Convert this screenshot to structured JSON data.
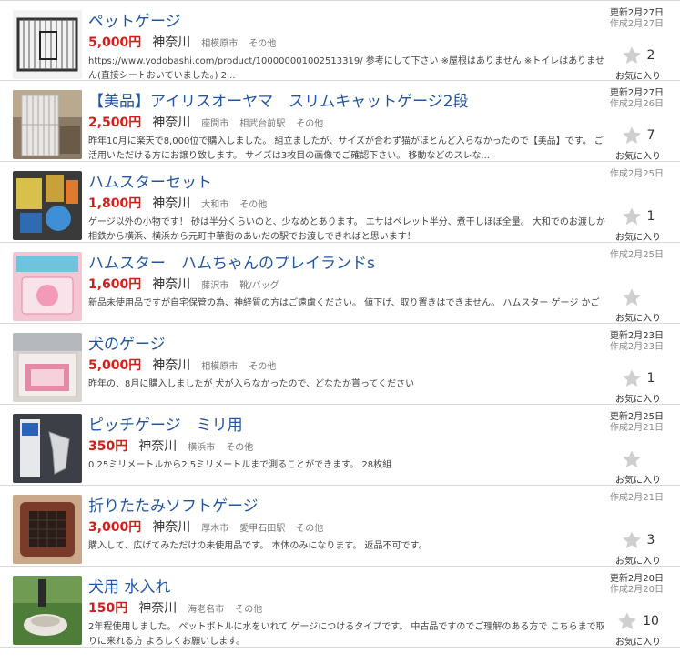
{
  "listings": [
    {
      "title": "ペットゲージ",
      "price": "5,000円",
      "prefecture": "神奈川",
      "city": "相模原市",
      "station": "",
      "category": "その他",
      "description": "https://www.yodobashi.com/product/100000001002513319/ 参考にして下さい ※屋根はありません ※トイレはありません(直接シートおいていました。) 2...",
      "updated": "更新2月27日",
      "created": "作成2月27日",
      "favorites": "2",
      "favorites_label": "お気に入り",
      "thumbnail": "cage-photo"
    },
    {
      "title": "【美品】アイリスオーヤマ　スリムキャットゲージ2段",
      "price": "2,500円",
      "prefecture": "神奈川",
      "city": "座間市",
      "station": "相武台前駅",
      "category": "その他",
      "description": "昨年10月に楽天で8,000位で購入しました。 組立ましたが、サイズが合わず猫がほとんど入らなかったので【美品】です。 ご活用いただける方にお譲り致します。 サイズは3枚目の画像でご確認下さい。 移動などのスレな...",
      "updated": "更新2月27日",
      "created": "作成2月26日",
      "favorites": "7",
      "favorites_label": "お気に入り",
      "thumbnail": "cat-cage-photo"
    },
    {
      "title": "ハムスターセット",
      "price": "1,800円",
      "prefecture": "神奈川",
      "city": "大和市",
      "station": "",
      "category": "その他",
      "description": "ゲージ以外の小物です！ 砂は半分くらいのと、少なめとあります。 エサはペレット半分、煮干しほぼ全量。 大和でのお渡しか相鉄から横浜、横浜から元町中華街のあいだの駅でお渡しできればと思います！",
      "updated": "",
      "created": "作成2月25日",
      "favorites": "1",
      "favorites_label": "お気に入り",
      "thumbnail": "hamster-goods-photo"
    },
    {
      "title": "ハムスター　ハムちゃんのプレイランドs",
      "price": "1,600円",
      "prefecture": "神奈川",
      "city": "藤沢市",
      "station": "",
      "category": "靴/バッグ",
      "description": "新品未使用品ですが自宅保管の為、神経質の方はご遠慮ください。 値下げ、取り置きはできません。 ハムスター ゲージ かご",
      "updated": "",
      "created": "作成2月25日",
      "favorites": "",
      "favorites_label": "お気に入り",
      "thumbnail": "playland-box-photo"
    },
    {
      "title": "犬のゲージ",
      "price": "5,000円",
      "prefecture": "神奈川",
      "city": "相模原市",
      "station": "",
      "category": "その他",
      "description": "昨年の、8月に購入しましたが 犬が入らなかったので、どなたか貰ってください",
      "updated": "更新2月23日",
      "created": "作成2月23日",
      "favorites": "1",
      "favorites_label": "お気に入り",
      "thumbnail": "dog-cage-photo"
    },
    {
      "title": "ピッチゲージ　ミリ用",
      "price": "350円",
      "prefecture": "神奈川",
      "city": "横浜市",
      "station": "",
      "category": "その他",
      "description": "0.25ミリメートルから2.5ミリメートルまで測ることができます。 28枚組",
      "updated": "更新2月25日",
      "created": "作成2月21日",
      "favorites": "",
      "favorites_label": "お気に入り",
      "thumbnail": "pitch-gauge-photo"
    },
    {
      "title": "折りたたみソフトゲージ",
      "price": "3,000円",
      "prefecture": "神奈川",
      "city": "厚木市",
      "station": "愛甲石田駅",
      "category": "その他",
      "description": "購入して、広げてみただけの未使用品です。 本体のみになります。 返品不可です。",
      "updated": "",
      "created": "作成2月21日",
      "favorites": "3",
      "favorites_label": "お気に入り",
      "thumbnail": "soft-cage-photo"
    },
    {
      "title": "犬用 水入れ",
      "price": "150円",
      "prefecture": "神奈川",
      "city": "海老名市",
      "station": "",
      "category": "その他",
      "description": "2年程使用しました。 ペットボトルに水をいれて ゲージにつけるタイプです。 中古品ですのでご理解のある方で こちらまで取りに来れる方 よろしくお願いします。",
      "updated": "更新2月20日",
      "created": "作成2月20日",
      "favorites": "10",
      "favorites_label": "お気に入り",
      "thumbnail": "water-bowl-photo"
    }
  ],
  "colors": {
    "title": "#2255a4",
    "price": "#d1201a",
    "star": "#cfcfcf"
  }
}
